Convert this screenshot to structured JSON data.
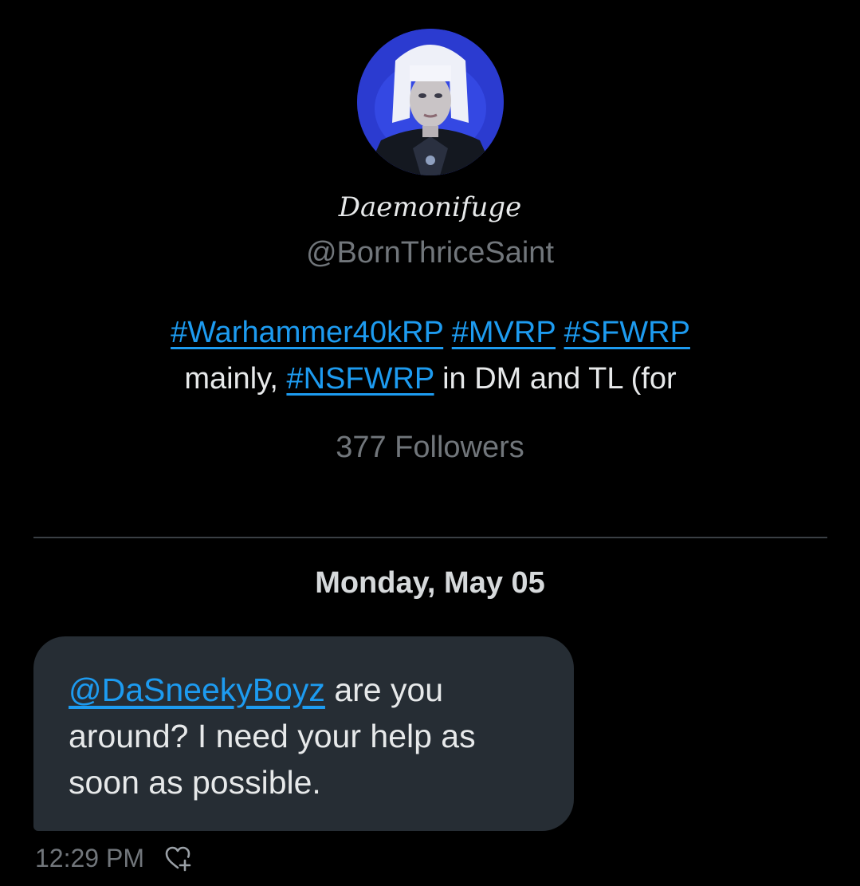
{
  "profile": {
    "avatar_icon": "profile-avatar",
    "display_name": "Daemonifuge",
    "handle": "@BornThriceSaint",
    "bio": {
      "tags_line1": [
        "#Warhammer40kRP",
        "#MVRP",
        "#SFWRP"
      ],
      "line2_prefix": "mainly,",
      "line2_tag": "#NSFWRP",
      "line2_suffix": "in DM and TL (for"
    },
    "followers_label": "377 Followers"
  },
  "conversation": {
    "date_label": "Monday, May 05",
    "messages": [
      {
        "mention": "@DaSneekyBoyz",
        "text": "are you around? I need your help as soon as possible.",
        "time": "12:29 PM",
        "reaction_icon": "heart-plus-icon"
      }
    ]
  },
  "colors": {
    "background": "#000000",
    "link": "#1d9bf0",
    "bubble": "#262d34",
    "muted": "#71767b",
    "text": "#e7e9ea"
  }
}
